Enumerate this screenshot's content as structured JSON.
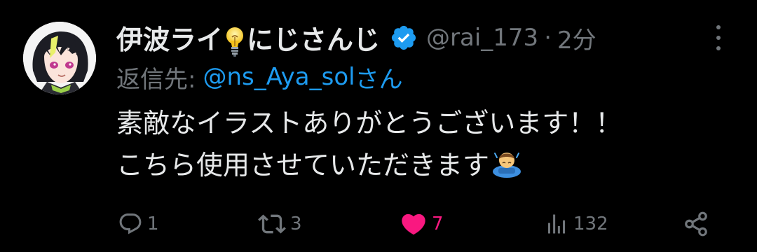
{
  "tweet": {
    "author": {
      "name_part1": "伊波ライ",
      "name_icon": "light-bulb-icon",
      "name_part2": "にじさんじ",
      "verified": true,
      "verified_color": "#1d9bf0",
      "handle": "@rai_173",
      "separator": "·",
      "time": "2分"
    },
    "reply_to": {
      "label": "返信先:",
      "user": "@ns_Aya_sol",
      "suffix": "さん"
    },
    "text": {
      "line1": "素敵なイラストありがとうございます！！",
      "line2": "こちら使用させていただきます",
      "trailing_icon": "bowing-person-icon"
    },
    "actions": {
      "reply_count": "1",
      "retweet_count": "3",
      "like_count": "7",
      "liked": true,
      "view_count": "132"
    },
    "colors": {
      "background": "#000000",
      "text": "#e7e9ea",
      "muted": "#71767b",
      "link": "#1d9bf0",
      "like": "#f91880"
    }
  }
}
